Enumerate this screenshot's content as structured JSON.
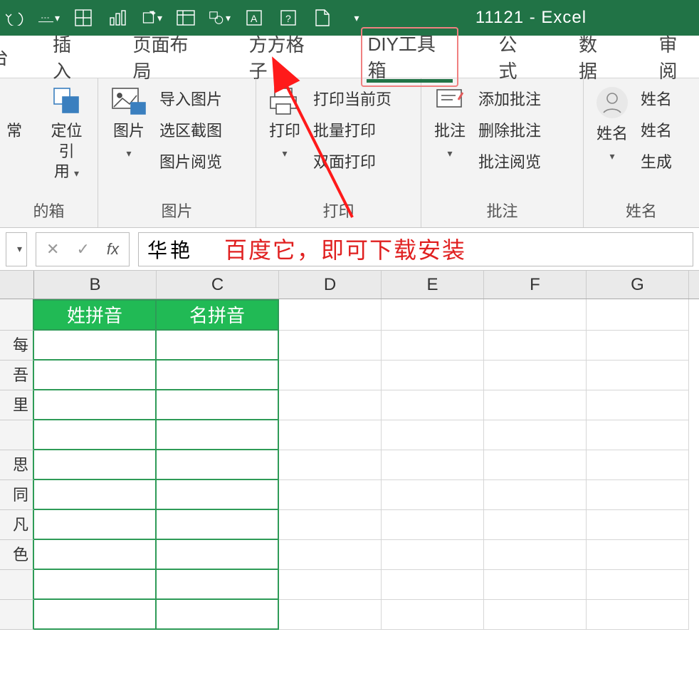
{
  "title": "11121  -  Excel",
  "tabs": {
    "partial_left": "台",
    "insert": "插入",
    "page_layout": "页面布局",
    "fangfang": "方方格子",
    "diy_toolbox": "DIY工具箱",
    "formula": "公式",
    "data": "数据",
    "review": "审阅"
  },
  "ribbon": {
    "group1": {
      "btn1_line1": "常",
      "btn2_line1": "定位引",
      "btn2_line2": "用",
      "label": "的箱"
    },
    "group_pic": {
      "btn_pic": "图片",
      "import_pic": "导入图片",
      "screenshot": "选区截图",
      "pic_view": "图片阅览",
      "label": "图片"
    },
    "group_print": {
      "btn_print": "打印",
      "print_current": "打印当前页",
      "batch_print": "批量打印",
      "duplex_print": "双面打印",
      "label": "打印"
    },
    "group_comment": {
      "btn_comment": "批注",
      "add_comment": "添加批注",
      "del_comment": "删除批注",
      "comment_view": "批注阅览",
      "label": "批注"
    },
    "group_name": {
      "btn_name": "姓名",
      "name1": "姓名",
      "name2": "姓名",
      "name3": "生成",
      "label": "姓名"
    }
  },
  "fnbar": {
    "fx_label": "fx",
    "cell_value": "华艳",
    "annotation_text": "百度它，即可下载安装"
  },
  "columns": [
    "B",
    "C",
    "D",
    "E",
    "F",
    "G"
  ],
  "row_fragments": [
    "",
    "每",
    "吾",
    "里",
    "",
    "思",
    "同",
    "凡",
    "色",
    ""
  ],
  "headers": {
    "b": "姓拼音",
    "c": "名拼音"
  }
}
